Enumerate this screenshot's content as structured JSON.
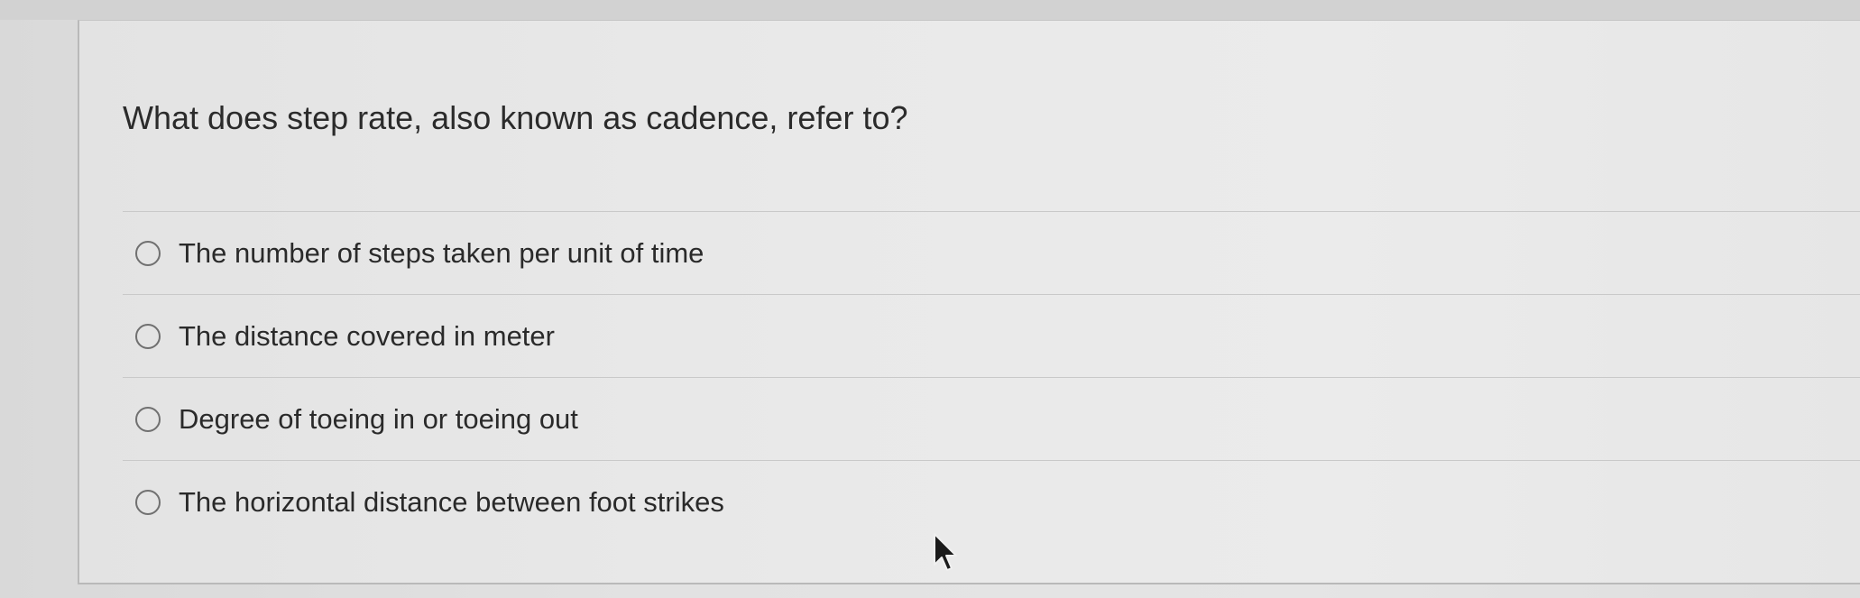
{
  "question": {
    "text": "What does step rate, also known as cadence, refer to?"
  },
  "options": [
    {
      "label": "The number of steps taken per unit of time",
      "selected": false
    },
    {
      "label": "The distance covered in meter",
      "selected": false
    },
    {
      "label": "Degree of toeing in or toeing out",
      "selected": false
    },
    {
      "label": "The horizontal distance between foot strikes",
      "selected": false
    }
  ],
  "icons": {
    "radio": "radio-button-icon",
    "cursor": "mouse-pointer-icon"
  },
  "colors": {
    "text": "#2a2a2a",
    "radio_border": "#707070",
    "divider": "#c9c9c9"
  }
}
